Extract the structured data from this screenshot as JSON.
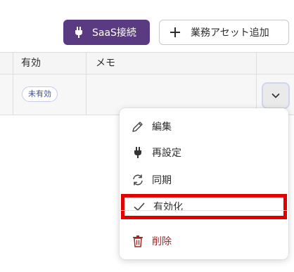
{
  "toolbar": {
    "saas_label": "SaaS接続",
    "add_asset_label": "業務アセット追加"
  },
  "table": {
    "columns": [
      "有効",
      "メモ"
    ],
    "row": {
      "status_badge": "未有効",
      "memo": ""
    }
  },
  "row_menu": {
    "items": [
      {
        "label": "編集",
        "icon": "pencil-icon"
      },
      {
        "label": "再設定",
        "icon": "plug-icon"
      },
      {
        "label": "同期",
        "icon": "sync-icon"
      },
      {
        "label": "有効化",
        "icon": "check-icon",
        "highlighted": true
      },
      {
        "label": "削除",
        "icon": "trash-icon",
        "danger": true
      }
    ]
  },
  "colors": {
    "primary": "#5a3b82",
    "highlight_border": "#e00000",
    "danger": "#9b2a2a",
    "badge_text": "#3c4aa6"
  }
}
